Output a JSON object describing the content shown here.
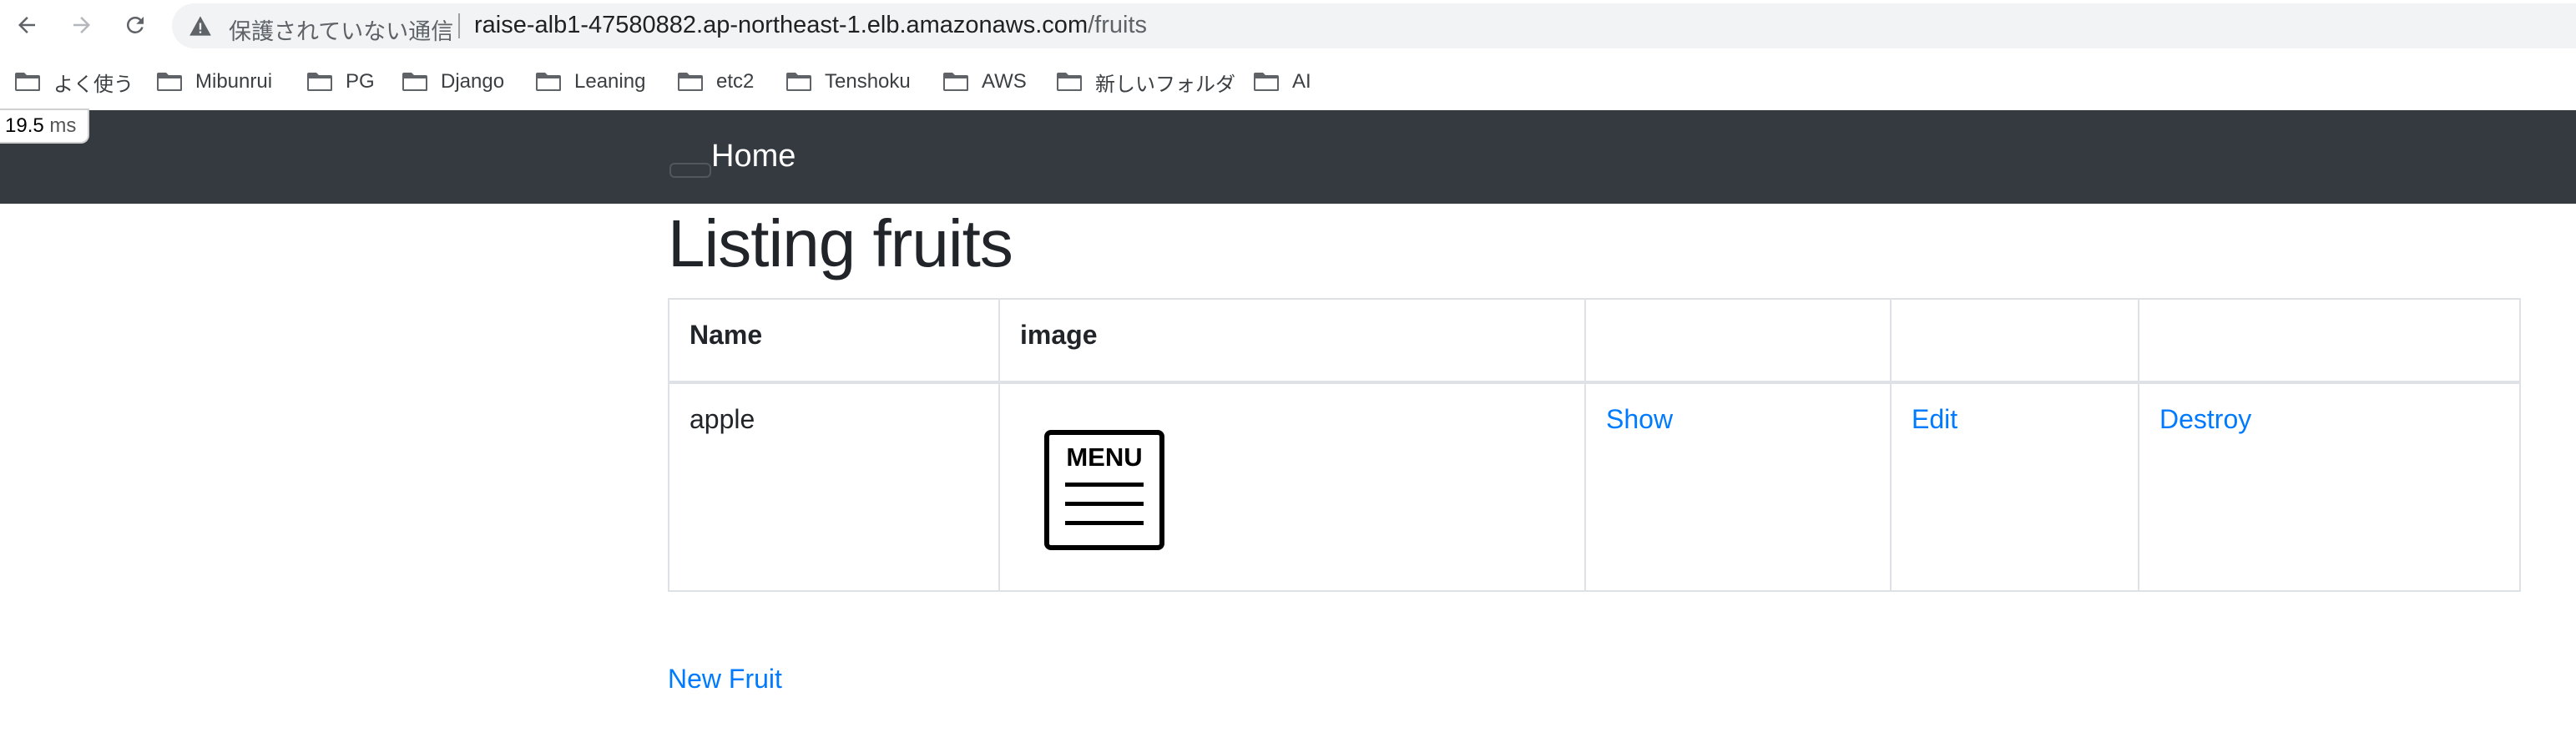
{
  "browser": {
    "security_label": "保護されていない通信",
    "url_host": "raise-alb1-47580882.ap-northeast-1.elb.amazonaws.com",
    "url_path": "/fruits",
    "bookmarks": [
      "よく使う",
      "Mibunrui",
      "PG",
      "Django",
      "Leaning",
      "etc2",
      "Tenshoku",
      "AWS",
      "新しいフォルダ",
      "AI"
    ]
  },
  "timing": {
    "value": "19.5",
    "unit": "ms"
  },
  "navbar": {
    "brand": "Home"
  },
  "page": {
    "title": "Listing fruits",
    "new_link": "New Fruit"
  },
  "table": {
    "headers": [
      "Name",
      "image",
      "",
      "",
      ""
    ],
    "rows": [
      {
        "name": "apple",
        "image_label": "MENU",
        "show": "Show",
        "edit": "Edit",
        "destroy": "Destroy"
      }
    ]
  },
  "colors": {
    "navbar_bg": "#343a40",
    "link": "#007bff",
    "text": "#212529",
    "table_border": "#dee2e6"
  }
}
